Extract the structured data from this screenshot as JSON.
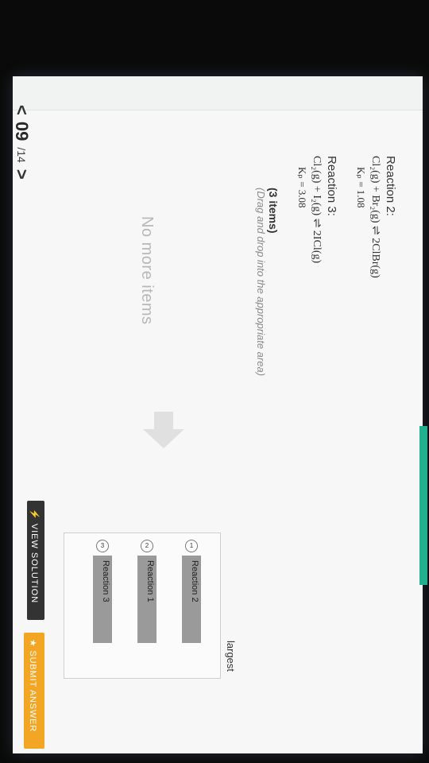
{
  "nav": {
    "prev_icon": "<",
    "current": "09",
    "total": "/14",
    "next_icon": ">"
  },
  "reaction2": {
    "title": "Reaction 2:",
    "equation": "Cl₂(g) + Br₂(g) ⇌ 2ClBr(g)",
    "kp": "Kₚ  =  1.08"
  },
  "reaction3": {
    "title": "Reaction 3:",
    "equation": "Cl₂(g) + I₂(g) ⇌ 2ICl(g)",
    "kp": "Kₚ  =  3.08"
  },
  "dragdrop": {
    "count": "(3 items)",
    "hint": "(Drag and drop into the appropriate area)",
    "no_more": "No more items"
  },
  "ranking": {
    "largest_label": "largest",
    "slots": [
      {
        "num": "1",
        "label": "Reaction 2"
      },
      {
        "num": "2",
        "label": "Reaction 1"
      },
      {
        "num": "3",
        "label": "Reaction 3"
      }
    ]
  },
  "buttons": {
    "view_solution": "⚡ VIEW SOLUTION",
    "submit_answer": "★ SUBMIT ANSWER"
  },
  "colors": {
    "accent_green": "#22b08f",
    "submit_orange": "#f2a623",
    "slot_gray": "#9a9a9a",
    "dark_button": "#333333"
  },
  "icons": {
    "arrow": "arrow-right-icon",
    "prev": "chevron-left-icon",
    "next": "chevron-right-icon"
  }
}
